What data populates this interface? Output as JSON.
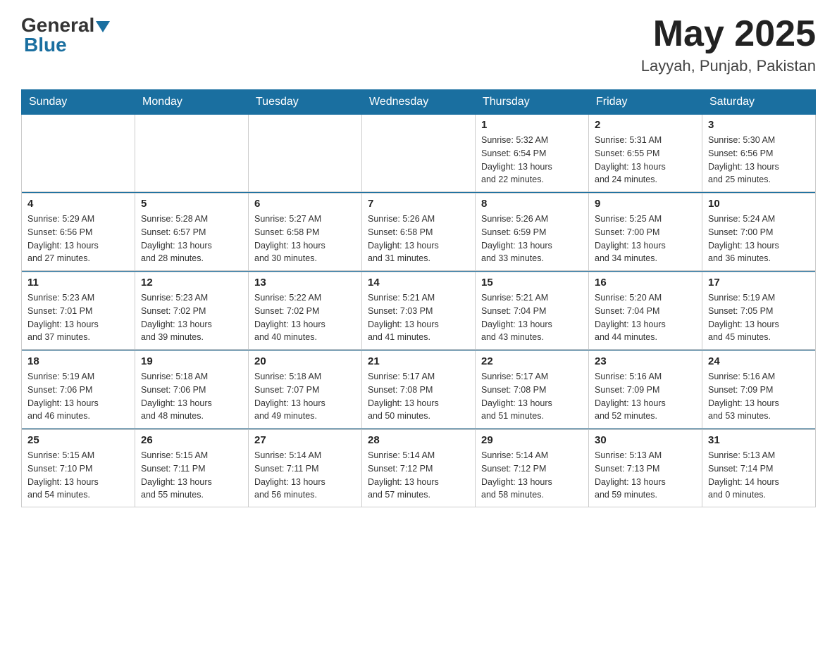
{
  "header": {
    "logo_general": "General",
    "logo_blue": "Blue",
    "month_title": "May 2025",
    "location": "Layyah, Punjab, Pakistan"
  },
  "days_of_week": [
    "Sunday",
    "Monday",
    "Tuesday",
    "Wednesday",
    "Thursday",
    "Friday",
    "Saturday"
  ],
  "weeks": [
    {
      "days": [
        {
          "number": "",
          "info": ""
        },
        {
          "number": "",
          "info": ""
        },
        {
          "number": "",
          "info": ""
        },
        {
          "number": "",
          "info": ""
        },
        {
          "number": "1",
          "info": "Sunrise: 5:32 AM\nSunset: 6:54 PM\nDaylight: 13 hours\nand 22 minutes."
        },
        {
          "number": "2",
          "info": "Sunrise: 5:31 AM\nSunset: 6:55 PM\nDaylight: 13 hours\nand 24 minutes."
        },
        {
          "number": "3",
          "info": "Sunrise: 5:30 AM\nSunset: 6:56 PM\nDaylight: 13 hours\nand 25 minutes."
        }
      ]
    },
    {
      "days": [
        {
          "number": "4",
          "info": "Sunrise: 5:29 AM\nSunset: 6:56 PM\nDaylight: 13 hours\nand 27 minutes."
        },
        {
          "number": "5",
          "info": "Sunrise: 5:28 AM\nSunset: 6:57 PM\nDaylight: 13 hours\nand 28 minutes."
        },
        {
          "number": "6",
          "info": "Sunrise: 5:27 AM\nSunset: 6:58 PM\nDaylight: 13 hours\nand 30 minutes."
        },
        {
          "number": "7",
          "info": "Sunrise: 5:26 AM\nSunset: 6:58 PM\nDaylight: 13 hours\nand 31 minutes."
        },
        {
          "number": "8",
          "info": "Sunrise: 5:26 AM\nSunset: 6:59 PM\nDaylight: 13 hours\nand 33 minutes."
        },
        {
          "number": "9",
          "info": "Sunrise: 5:25 AM\nSunset: 7:00 PM\nDaylight: 13 hours\nand 34 minutes."
        },
        {
          "number": "10",
          "info": "Sunrise: 5:24 AM\nSunset: 7:00 PM\nDaylight: 13 hours\nand 36 minutes."
        }
      ]
    },
    {
      "days": [
        {
          "number": "11",
          "info": "Sunrise: 5:23 AM\nSunset: 7:01 PM\nDaylight: 13 hours\nand 37 minutes."
        },
        {
          "number": "12",
          "info": "Sunrise: 5:23 AM\nSunset: 7:02 PM\nDaylight: 13 hours\nand 39 minutes."
        },
        {
          "number": "13",
          "info": "Sunrise: 5:22 AM\nSunset: 7:02 PM\nDaylight: 13 hours\nand 40 minutes."
        },
        {
          "number": "14",
          "info": "Sunrise: 5:21 AM\nSunset: 7:03 PM\nDaylight: 13 hours\nand 41 minutes."
        },
        {
          "number": "15",
          "info": "Sunrise: 5:21 AM\nSunset: 7:04 PM\nDaylight: 13 hours\nand 43 minutes."
        },
        {
          "number": "16",
          "info": "Sunrise: 5:20 AM\nSunset: 7:04 PM\nDaylight: 13 hours\nand 44 minutes."
        },
        {
          "number": "17",
          "info": "Sunrise: 5:19 AM\nSunset: 7:05 PM\nDaylight: 13 hours\nand 45 minutes."
        }
      ]
    },
    {
      "days": [
        {
          "number": "18",
          "info": "Sunrise: 5:19 AM\nSunset: 7:06 PM\nDaylight: 13 hours\nand 46 minutes."
        },
        {
          "number": "19",
          "info": "Sunrise: 5:18 AM\nSunset: 7:06 PM\nDaylight: 13 hours\nand 48 minutes."
        },
        {
          "number": "20",
          "info": "Sunrise: 5:18 AM\nSunset: 7:07 PM\nDaylight: 13 hours\nand 49 minutes."
        },
        {
          "number": "21",
          "info": "Sunrise: 5:17 AM\nSunset: 7:08 PM\nDaylight: 13 hours\nand 50 minutes."
        },
        {
          "number": "22",
          "info": "Sunrise: 5:17 AM\nSunset: 7:08 PM\nDaylight: 13 hours\nand 51 minutes."
        },
        {
          "number": "23",
          "info": "Sunrise: 5:16 AM\nSunset: 7:09 PM\nDaylight: 13 hours\nand 52 minutes."
        },
        {
          "number": "24",
          "info": "Sunrise: 5:16 AM\nSunset: 7:09 PM\nDaylight: 13 hours\nand 53 minutes."
        }
      ]
    },
    {
      "days": [
        {
          "number": "25",
          "info": "Sunrise: 5:15 AM\nSunset: 7:10 PM\nDaylight: 13 hours\nand 54 minutes."
        },
        {
          "number": "26",
          "info": "Sunrise: 5:15 AM\nSunset: 7:11 PM\nDaylight: 13 hours\nand 55 minutes."
        },
        {
          "number": "27",
          "info": "Sunrise: 5:14 AM\nSunset: 7:11 PM\nDaylight: 13 hours\nand 56 minutes."
        },
        {
          "number": "28",
          "info": "Sunrise: 5:14 AM\nSunset: 7:12 PM\nDaylight: 13 hours\nand 57 minutes."
        },
        {
          "number": "29",
          "info": "Sunrise: 5:14 AM\nSunset: 7:12 PM\nDaylight: 13 hours\nand 58 minutes."
        },
        {
          "number": "30",
          "info": "Sunrise: 5:13 AM\nSunset: 7:13 PM\nDaylight: 13 hours\nand 59 minutes."
        },
        {
          "number": "31",
          "info": "Sunrise: 5:13 AM\nSunset: 7:14 PM\nDaylight: 14 hours\nand 0 minutes."
        }
      ]
    }
  ]
}
